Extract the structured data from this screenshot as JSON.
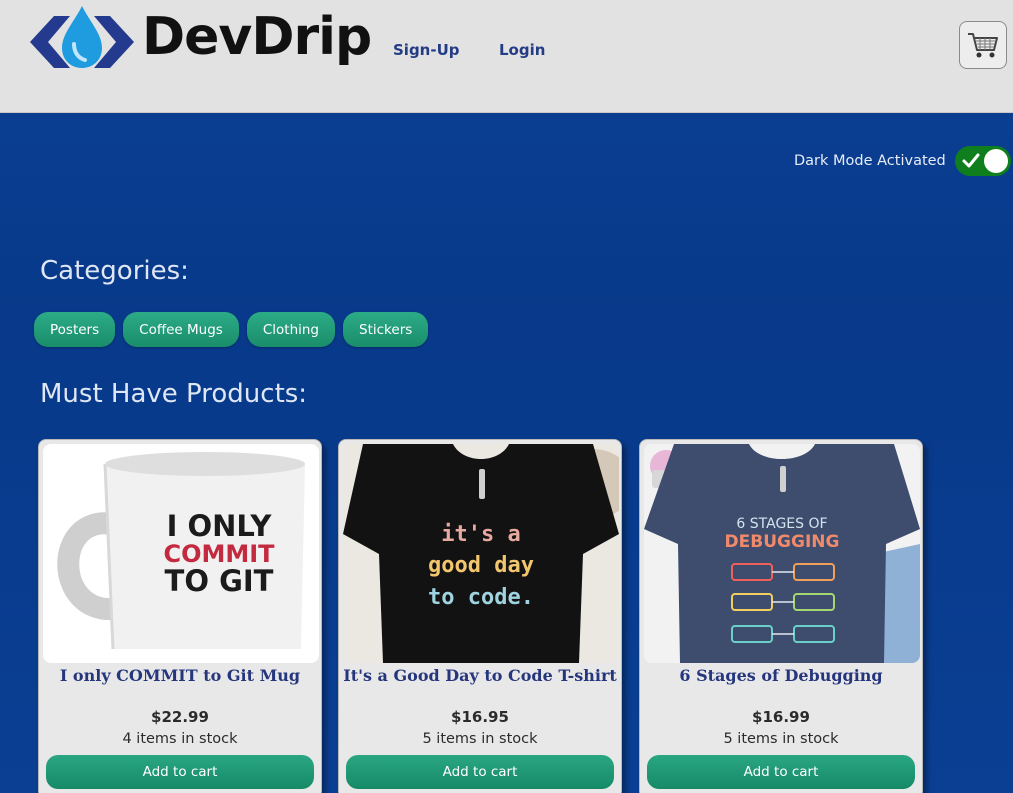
{
  "header": {
    "brand": "DevDrip",
    "nav": [
      {
        "label": "Sign-Up"
      },
      {
        "label": "Login"
      }
    ],
    "cart_icon": "shopping-cart-icon"
  },
  "theme": {
    "dark_mode_label": "Dark Mode Activated",
    "dark_mode_on": true,
    "toggle_color": "#0f7f1e"
  },
  "categories": {
    "title": "Categories:",
    "items": [
      {
        "label": "Posters"
      },
      {
        "label": "Coffee Mugs"
      },
      {
        "label": "Clothing"
      },
      {
        "label": "Stickers"
      }
    ]
  },
  "products": {
    "title": "Must Have Products:",
    "items": [
      {
        "name": "I only COMMIT to Git Mug",
        "price": "$22.99",
        "stock": "4 items in stock",
        "add_label": "Add to cart",
        "image_text": [
          "I ONLY",
          "COMMIT",
          "TO GIT"
        ]
      },
      {
        "name": "It's a Good Day to Code T-shirt",
        "price": "$16.95",
        "stock": "5 items in stock",
        "add_label": "Add to cart",
        "image_text": [
          "it's a",
          "good day",
          "to code."
        ]
      },
      {
        "name": "6 Stages of Debugging",
        "price": "$16.99",
        "stock": "5 items in stock",
        "add_label": "Add to cart",
        "image_text": [
          "6 STAGES OF",
          "DEBUGGING"
        ]
      }
    ]
  },
  "colors": {
    "background": "#0b4194",
    "header_bg": "#e2e2e2",
    "accent_green": "#1a8d6a",
    "product_name": "#26367d"
  }
}
